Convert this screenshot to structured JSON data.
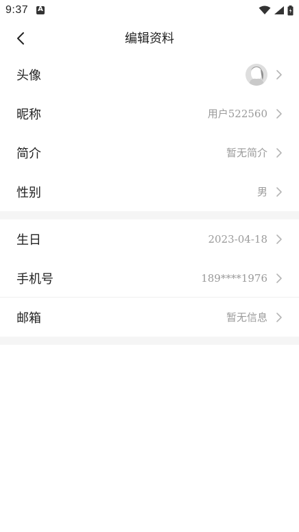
{
  "status_bar": {
    "time": "9:37",
    "icons": [
      "wifi-icon",
      "signal-icon",
      "battery-icon"
    ]
  },
  "header": {
    "title": "编辑资料",
    "back_icon": "chevron-left-icon"
  },
  "profile": {
    "avatar_label": "头像",
    "nickname_label": "昵称",
    "nickname_value": "用户522560",
    "intro_label": "简介",
    "intro_value": "暂无简介",
    "gender_label": "性别",
    "gender_value": "男"
  },
  "contact": {
    "birthday_label": "生日",
    "birthday_value": "2023-04-18",
    "phone_label": "手机号",
    "phone_value": "189****1976",
    "email_label": "邮箱",
    "email_value": "暂无信息"
  },
  "colors": {
    "text_primary": "#222222",
    "text_secondary": "#9a9a9a",
    "section_gap": "#f5f5f5"
  }
}
